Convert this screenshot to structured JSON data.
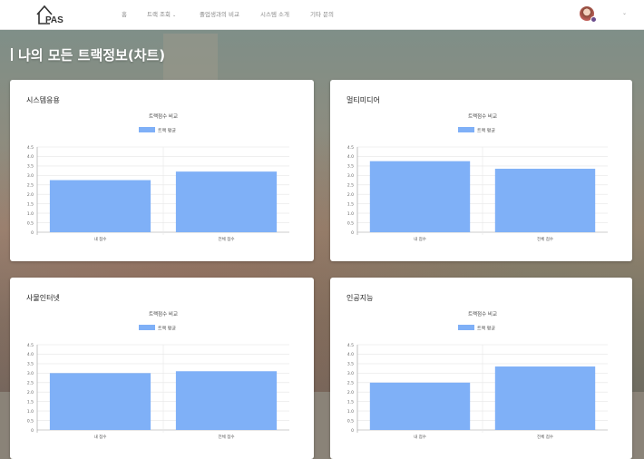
{
  "nav": {
    "logo_text": "PAS",
    "menu": [
      {
        "label": "홈"
      },
      {
        "label": "트랙 조회",
        "has_dropdown": true
      },
      {
        "label": "졸업생과의 비교"
      },
      {
        "label": "시스템 소개"
      },
      {
        "label": "기타 문의"
      }
    ],
    "user_dropdown_icon": "chevron-down-icon"
  },
  "page_title": "나의 모든 트랙정보(차트)",
  "colors": {
    "bar": "#7fb0f7",
    "accent": "#ffffff"
  },
  "cards": [
    {
      "title": "시스템응용"
    },
    {
      "title": "멀티미디어"
    },
    {
      "title": "사물인터넷"
    },
    {
      "title": "인공지능"
    }
  ],
  "chart_data": [
    {
      "type": "bar",
      "title": "트랙점수 비교",
      "legend": [
        "트랙 평균"
      ],
      "categories": [
        "내 점수",
        "전체 점수"
      ],
      "series": [
        {
          "name": "트랙 평균",
          "values": [
            2.75,
            3.2
          ]
        }
      ],
      "ylim": [
        0,
        4.5
      ],
      "yticks": [
        "4.5",
        "4.0",
        "3.5",
        "3.0",
        "2.5",
        "2.0",
        "1.5",
        "1.0",
        "0.5",
        "0"
      ]
    },
    {
      "type": "bar",
      "title": "트랙점수 비교",
      "legend": [
        "트랙 평균"
      ],
      "categories": [
        "내 점수",
        "전체 점수"
      ],
      "series": [
        {
          "name": "트랙 평균",
          "values": [
            3.75,
            3.35
          ]
        }
      ],
      "ylim": [
        0,
        4.5
      ],
      "yticks": [
        "4.5",
        "4.0",
        "3.5",
        "3.0",
        "2.5",
        "2.0",
        "1.5",
        "1.0",
        "0.5",
        "0"
      ]
    },
    {
      "type": "bar",
      "title": "트랙점수 비교",
      "legend": [
        "트랙 평균"
      ],
      "categories": [
        "내 점수",
        "전체 점수"
      ],
      "series": [
        {
          "name": "트랙 평균",
          "values": [
            3.0,
            3.1
          ]
        }
      ],
      "ylim": [
        0,
        4.5
      ],
      "yticks": [
        "4.5",
        "4.0",
        "3.5",
        "3.0",
        "2.5",
        "2.0",
        "1.5",
        "1.0",
        "0.5",
        "0"
      ]
    },
    {
      "type": "bar",
      "title": "트랙점수 비교",
      "legend": [
        "트랙 평균"
      ],
      "categories": [
        "내 점수",
        "전체 점수"
      ],
      "series": [
        {
          "name": "트랙 평균",
          "values": [
            2.5,
            3.35
          ]
        }
      ],
      "ylim": [
        0,
        4.5
      ],
      "yticks": [
        "4.5",
        "4.0",
        "3.5",
        "3.0",
        "2.5",
        "2.0",
        "1.5",
        "1.0",
        "0.5",
        "0"
      ]
    }
  ]
}
